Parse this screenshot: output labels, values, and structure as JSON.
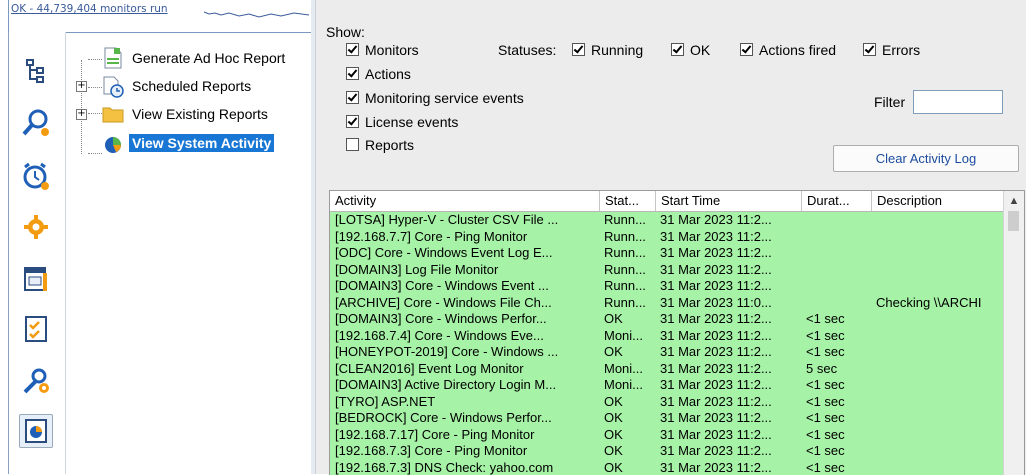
{
  "status_strip": {
    "text": "OK - 44,739,404 monitors run"
  },
  "sidebar_icons": [
    {
      "name": "hierarchy-icon"
    },
    {
      "name": "search-user-icon"
    },
    {
      "name": "alarm-clock-icon"
    },
    {
      "name": "gear-icon"
    },
    {
      "name": "calendar-icon"
    },
    {
      "name": "checklist-icon"
    },
    {
      "name": "tools-icon"
    },
    {
      "name": "reports-icon",
      "selected": true
    }
  ],
  "tree": {
    "items": [
      {
        "label": "Generate Ad Hoc Report",
        "icon": "document-icon"
      },
      {
        "label": "Scheduled Reports",
        "icon": "schedule-icon"
      },
      {
        "label": "View Existing Reports",
        "icon": "folder-icon"
      },
      {
        "label": "View System Activity",
        "icon": "activity-icon",
        "selected": true
      }
    ]
  },
  "show_panel": {
    "title": "Show:",
    "checks": [
      {
        "label": "Monitors",
        "checked": true
      },
      {
        "label": "Actions",
        "checked": true
      },
      {
        "label": "Monitoring service events",
        "checked": true
      },
      {
        "label": "License events",
        "checked": true
      },
      {
        "label": "Reports",
        "checked": false
      }
    ],
    "statuses_label": "Statuses:",
    "statuses": [
      {
        "label": "Running",
        "checked": true
      },
      {
        "label": "OK",
        "checked": true
      },
      {
        "label": "Actions fired",
        "checked": true
      },
      {
        "label": "Errors",
        "checked": true
      }
    ],
    "filter_label": "Filter",
    "filter_value": "",
    "clear_button": "Clear Activity Log"
  },
  "grid": {
    "columns": [
      "Activity",
      "Stat...",
      "Start Time",
      "Durat...",
      "Description"
    ],
    "rows": [
      [
        "[LOTSA] Hyper-V - Cluster CSV File ...",
        "Runn...",
        "31 Mar 2023 11:2...",
        "",
        ""
      ],
      [
        "[192.168.7.7] Core - Ping Monitor",
        "Runn...",
        "31 Mar 2023 11:2...",
        "",
        ""
      ],
      [
        "[ODC] Core - Windows Event Log E...",
        "Runn...",
        "31 Mar 2023 11:2...",
        "",
        ""
      ],
      [
        "[DOMAIN3] Log File Monitor",
        "Runn...",
        "31 Mar 2023 11:2...",
        "",
        ""
      ],
      [
        "[DOMAIN3] Core - Windows Event ...",
        "Runn...",
        "31 Mar 2023 11:2...",
        "",
        ""
      ],
      [
        "[ARCHIVE] Core - Windows File Ch...",
        "Runn...",
        "31 Mar 2023 11:0...",
        "",
        "Checking \\\\ARCHI"
      ],
      [
        "[DOMAIN3] Core - Windows Perfor...",
        "OK",
        "31 Mar 2023 11:2...",
        "<1 sec",
        ""
      ],
      [
        "[192.168.7.4] Core - Windows Eve...",
        "Moni...",
        "31 Mar 2023 11:2...",
        "<1 sec",
        ""
      ],
      [
        "[HONEYPOT-2019] Core - Windows ...",
        "OK",
        "31 Mar 2023 11:2...",
        "<1 sec",
        ""
      ],
      [
        "[CLEAN2016] Event Log Monitor",
        "Moni...",
        "31 Mar 2023 11:2...",
        "5 sec",
        ""
      ],
      [
        "[DOMAIN3] Active Directory Login M...",
        "Moni...",
        "31 Mar 2023 11:2...",
        "<1 sec",
        ""
      ],
      [
        "[TYRO] ASP.NET",
        "OK",
        "31 Mar 2023 11:2...",
        "<1 sec",
        ""
      ],
      [
        "[BEDROCK] Core - Windows Perfor...",
        "OK",
        "31 Mar 2023 11:2...",
        "<1 sec",
        ""
      ],
      [
        "[192.168.7.17] Core - Ping Monitor",
        "OK",
        "31 Mar 2023 11:2...",
        "<1 sec",
        ""
      ],
      [
        "[192.168.7.3] Core - Ping Monitor",
        "OK",
        "31 Mar 2023 11:2...",
        "<1 sec",
        ""
      ],
      [
        "[192.168.7.3] DNS Check: yahoo.com",
        "OK",
        "31 Mar 2023 11:2...",
        "<1 sec",
        ""
      ]
    ],
    "row_color": "#a6f2a6"
  }
}
